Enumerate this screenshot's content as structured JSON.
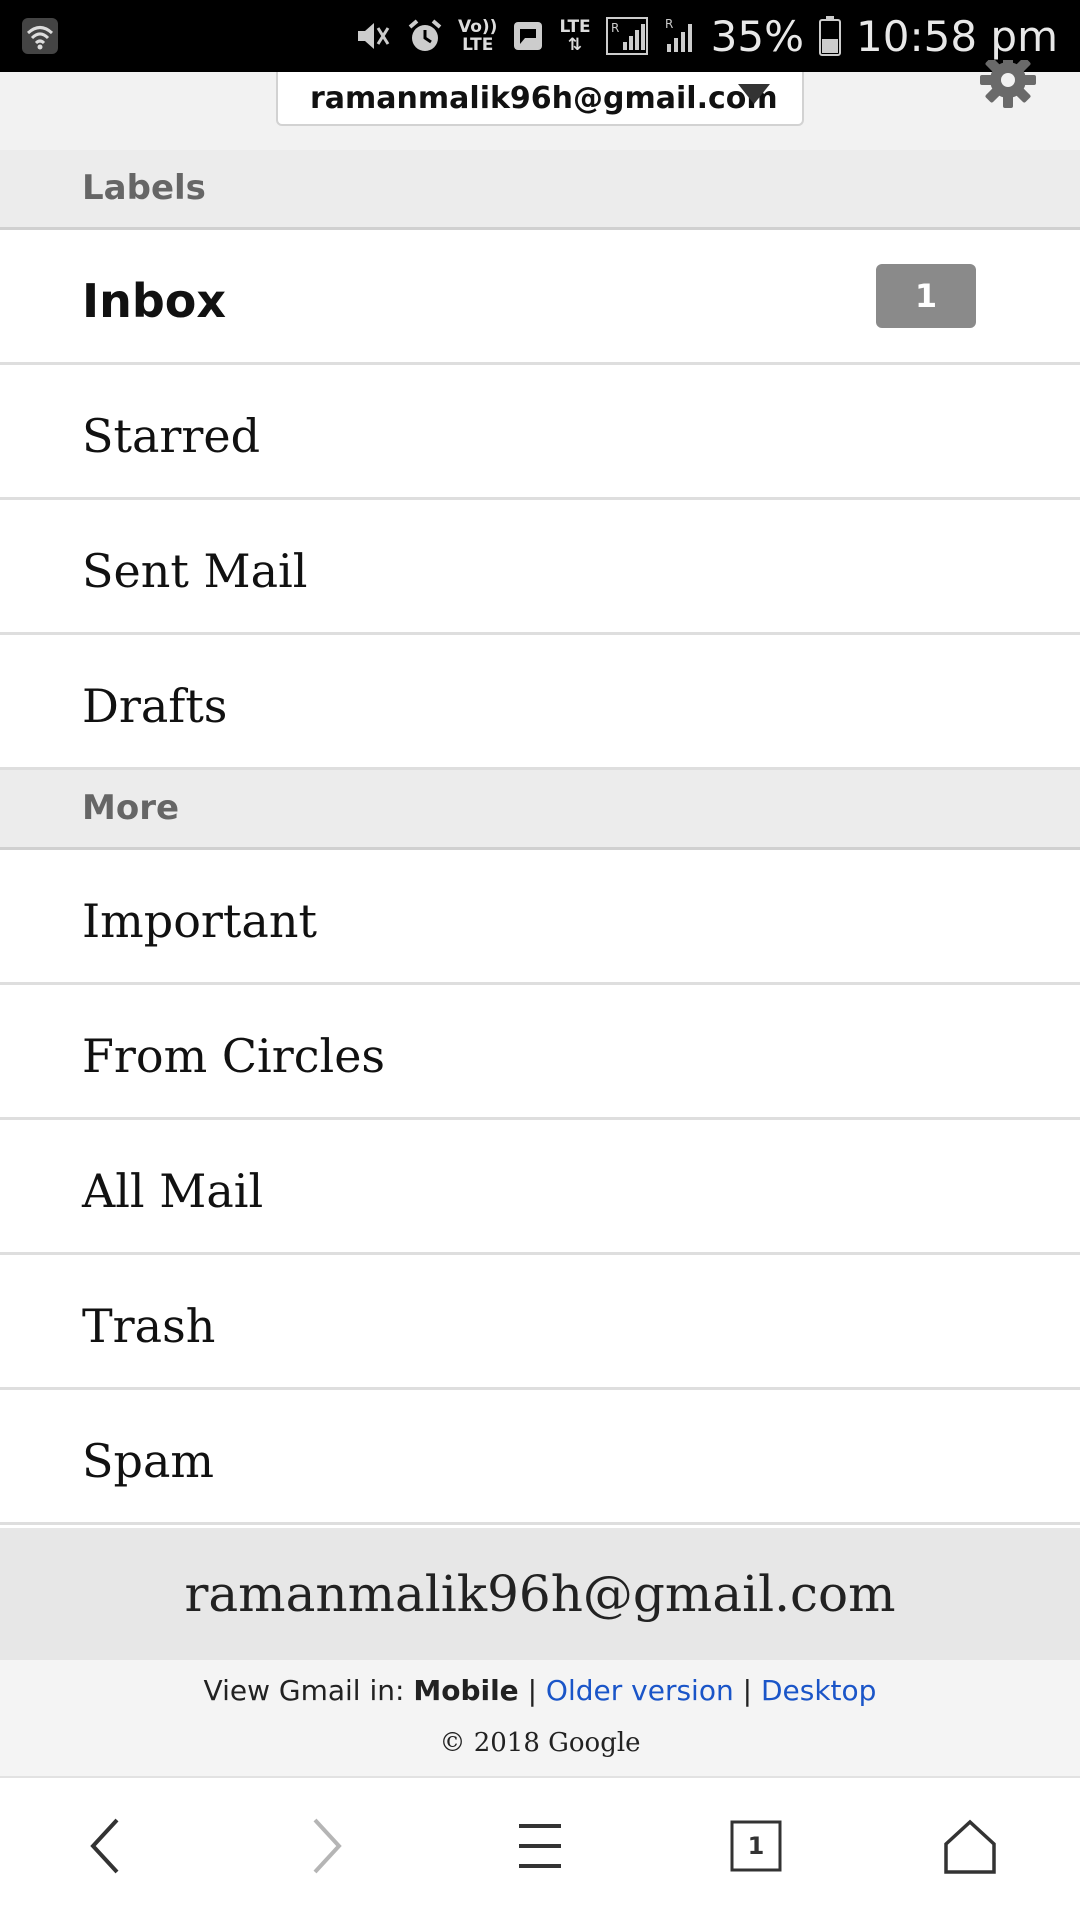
{
  "status_bar": {
    "volte": "Vo))",
    "volte_sub": "LTE",
    "lte": "LTE",
    "roaming": "R",
    "battery_percent": "35%",
    "time": "10:58 pm",
    "icons": [
      "wifi-icon",
      "mute-icon",
      "alarm-icon",
      "message-icon",
      "signal-icon",
      "battery-icon"
    ]
  },
  "account": {
    "selector_email": "ramanmalik96h@gmail.com"
  },
  "labels_section": {
    "title": "Labels",
    "items": [
      {
        "label": "Inbox",
        "badge": "1"
      },
      {
        "label": "Starred"
      },
      {
        "label": "Sent Mail"
      },
      {
        "label": "Drafts"
      }
    ]
  },
  "more_section": {
    "title": "More",
    "items": [
      {
        "label": "Important"
      },
      {
        "label": "From Circles"
      },
      {
        "label": "All Mail"
      },
      {
        "label": "Trash"
      },
      {
        "label": "Spam"
      }
    ]
  },
  "footer": {
    "email": "ramanmalik96h@gmail.com",
    "view_prefix": "View Gmail in:",
    "mobile": "Mobile",
    "separator": "|",
    "older_version": "Older version",
    "desktop": "Desktop",
    "copyright": "© 2018 Google"
  },
  "browser_nav": {
    "tab_count": "1",
    "icons": [
      "back-icon",
      "forward-icon",
      "menu-icon",
      "tabs-icon",
      "home-icon"
    ]
  },
  "colors": {
    "link": "#1a55c8",
    "badge": "#8a8a8a",
    "section_bg": "#ececec"
  }
}
